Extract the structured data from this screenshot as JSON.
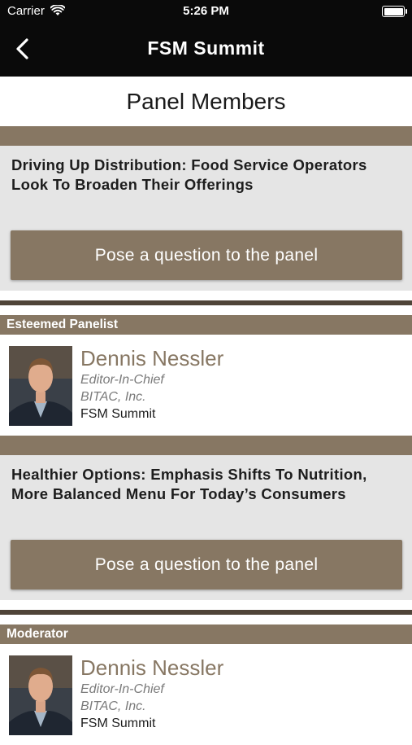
{
  "status": {
    "carrier": "Carrier",
    "time": "5:26 PM"
  },
  "nav": {
    "title": "FSM Summit",
    "back_icon": "chevron-left-icon"
  },
  "page": {
    "title": "Panel Members"
  },
  "sessions": [
    {
      "title": "Driving Up Distribution: Food Service Operators Look To Broaden Their Offerings",
      "button_label": "Pose a question to the panel",
      "role_header": "Esteemed Panelist",
      "member": {
        "name": "Dennis Nessler",
        "role": "Editor-In-Chief",
        "company": "BITAC, Inc.",
        "event": "FSM Summit"
      }
    },
    {
      "title": "Healthier Options: Emphasis Shifts To Nutrition, More Balanced Menu For Today’s Consumers",
      "button_label": "Pose a question to the panel",
      "role_header": "Moderator",
      "member": {
        "name": "Dennis Nessler",
        "role": "Editor-In-Chief",
        "company": "BITAC, Inc.",
        "event": "FSM Summit"
      }
    }
  ],
  "colors": {
    "accent_brown": "#877763",
    "dark_brown": "#4f4438",
    "nav_bg": "#0a0a0a",
    "session_bg": "#e5e5e5"
  }
}
